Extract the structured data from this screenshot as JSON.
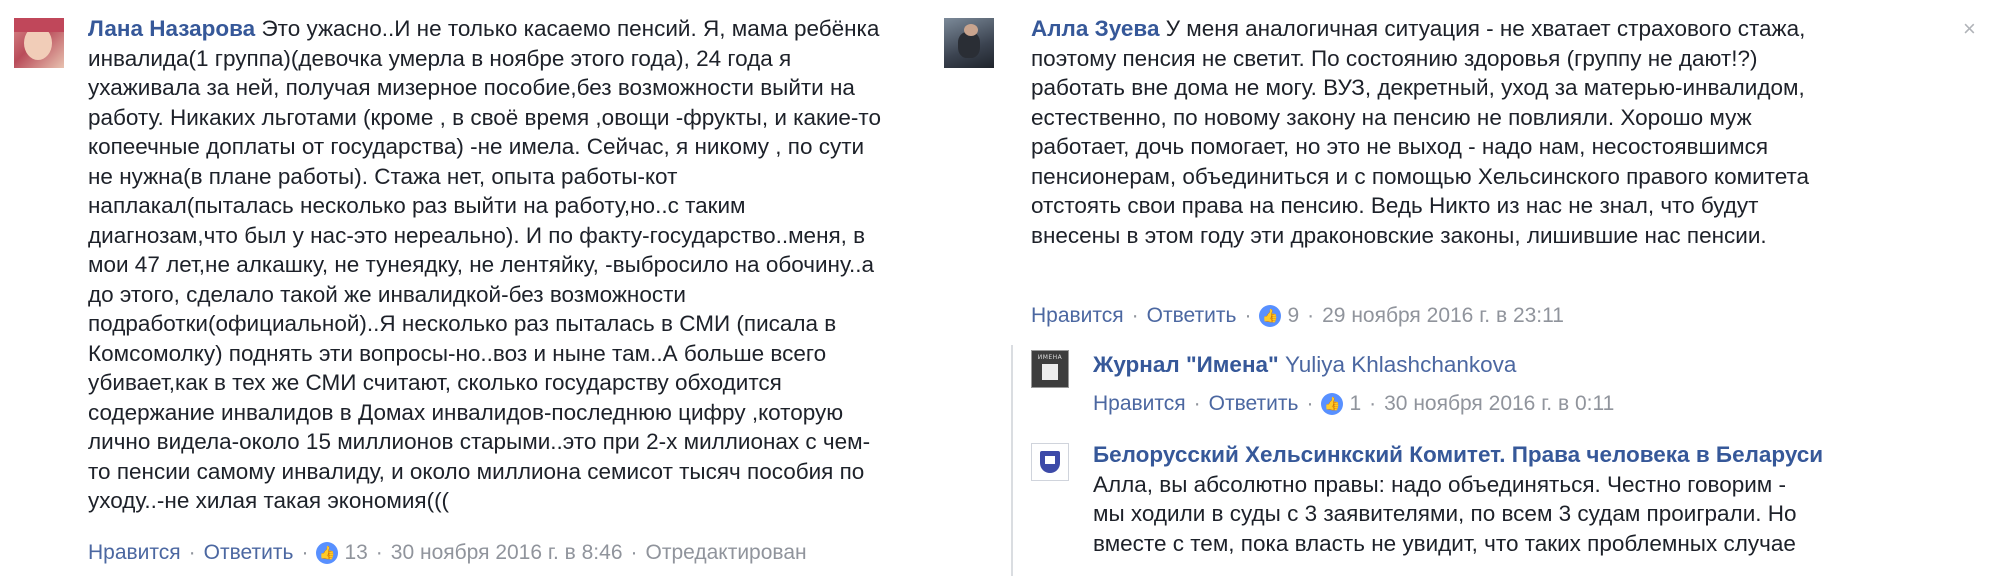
{
  "comments": [
    {
      "author": "Лана Назарова",
      "lines": [
        "Это ужасно..И не только касаемо пенсий. Я, мама ребёнка",
        "инвалида(1 группа)(девочка умерла в ноябре этого года), 24 года я",
        "ухаживала за ней, получая мизерное пособие,без возможности выйти на",
        "работу. Никаких льготами (кроме , в своё время ,овощи -фрукты, и какие-то",
        "копеечные доплаты от государства) -не имела. Сейчас, я никому , по сути",
        "не нужна(в плане работы). Стажа нет, опыта работы-кот",
        "наплакал(пыталась несколько раз выйти на работу,но..с таким",
        "диагнозам,что был у нас-это нереально). И по факту-государство..меня, в",
        "мои 47 лет,не алкашку, не тунеядку, не лентяйку, -выбросило на обочину..а",
        "до этого, сделало такой же инвалидкой-без возможности",
        "подработки(официальной)..Я несколько раз пыталась в СМИ (писала в",
        "Комсомолку) поднять эти вопросы-но..воз и ныне там..А больше всего",
        "убивает,как в тех же СМИ считают, сколько государству обходится",
        "содержание инвалидов в Домах инвалидов-последнюю цифру ,которую",
        "лично видела-около 15 миллионов старыми..это при 2-х миллионах с чем-",
        "то пенсии самому инвалиду, и около миллиона семисот тысяч пособия по",
        "уходу..-не хилая такая экономия((("
      ],
      "like_label": "Нравится",
      "reply_label": "Ответить",
      "likes": "13",
      "timestamp": "30 ноября 2016 г. в 8:46",
      "edited": "Отредактирован"
    },
    {
      "author": "Алла Зуева",
      "lines": [
        "У меня аналогичная ситуация - не хватает страхового стажа,",
        "поэтому пенсия не светит. По состоянию здоровья (группу не дают!?)",
        "работать вне дома не могу. ВУЗ, декретный, уход за матерью-инвалидом,",
        "естественно, по новому закону на пенсию не повлияли. Хорошо муж",
        "работает, дочь помогает, но это не выход - надо нам, несостоявшимся",
        "пенсионерам, объединиться и с помощью Хельсинского правого комитета",
        "отстоять свои права на пенсию. Ведь Никто из нас не знал, что будут",
        "внесены в этом году эти драконовские законы, лишившие нас пенсии."
      ],
      "like_label": "Нравится",
      "reply_label": "Ответить",
      "likes": "9",
      "timestamp": "29 ноября 2016 г. в 23:11"
    }
  ],
  "replies": [
    {
      "author": "Журнал \"Имена\"",
      "mention": "Yuliya Khlashchankova",
      "avatar_text": "ИМЕНА",
      "like_label": "Нравится",
      "reply_label": "Ответить",
      "likes": "1",
      "timestamp": "30 ноября 2016 г. в 0:11"
    },
    {
      "author": "Белорусский Хельсинкский Комитет. Права человека в Беларуси",
      "lines": [
        "Алла, вы абсолютно правы: надо объединяться. Честно говорим -",
        "мы ходили в суды с 3 заявителями, по всем 3 судам проиграли. Но",
        "вместе с тем, пока власть не увидит, что таких проблемных случае"
      ]
    }
  ],
  "close_symbol": "×",
  "colors": {
    "author": "#365899",
    "link": "#4b67a1",
    "meta": "#90949c",
    "like": "#5890ff"
  }
}
